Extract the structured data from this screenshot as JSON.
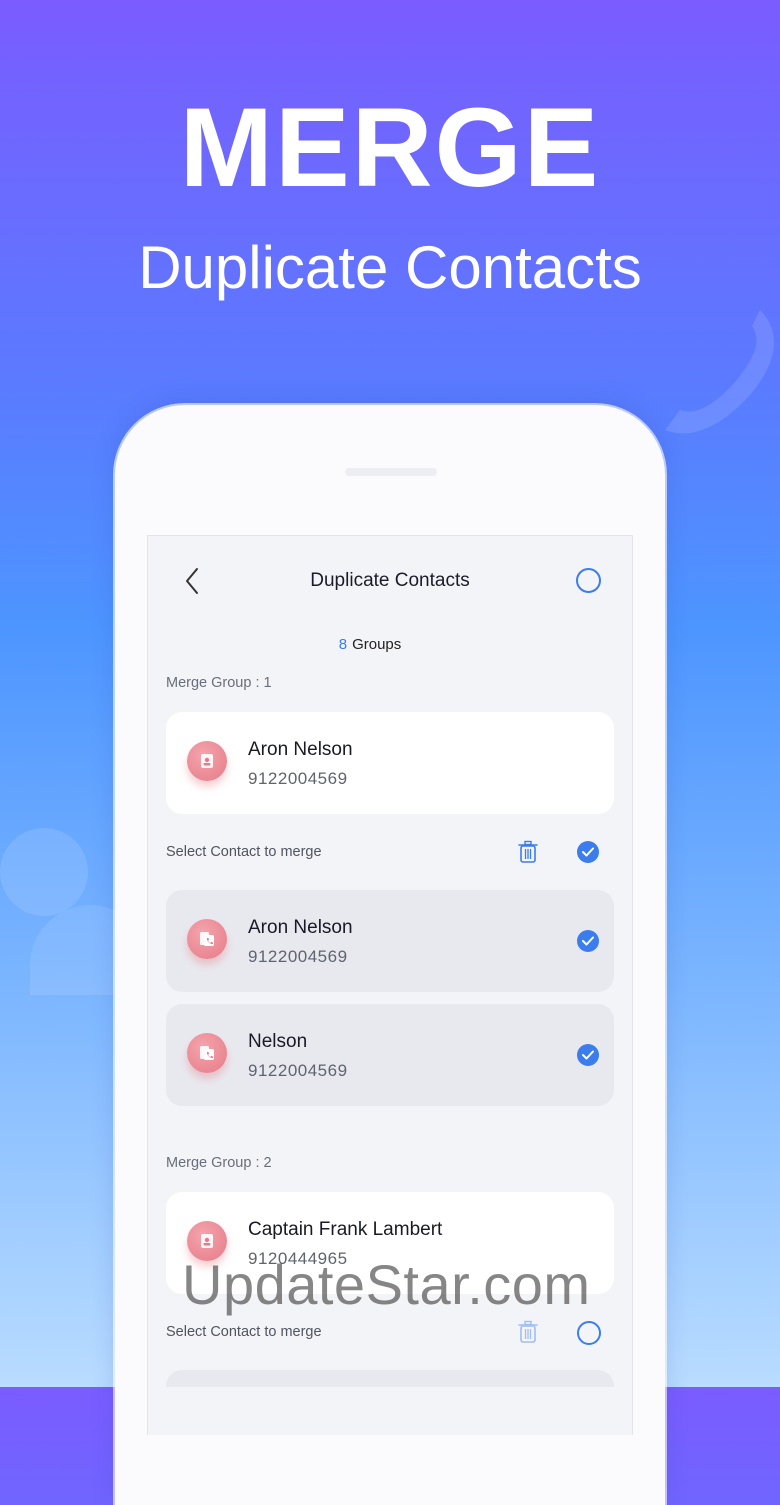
{
  "hero": {
    "title": "MERGE",
    "subtitle": "Duplicate Contacts"
  },
  "screen": {
    "nav_title": "Duplicate Contacts",
    "groups_count": "8",
    "groups_label": "Groups",
    "groups": [
      {
        "label": "Merge Group : 1",
        "primary": {
          "name": "Aron Nelson",
          "phone": "9122004569"
        },
        "select_label": "Select Contact to merge",
        "duplicates": [
          {
            "name": "Aron Nelson",
            "phone": "9122004569",
            "checked": true
          },
          {
            "name": "Nelson",
            "phone": "9122004569",
            "checked": true
          }
        ]
      },
      {
        "label": "Merge Group : 2",
        "primary": {
          "name": "Captain Frank Lambert",
          "phone": "9120444965"
        },
        "select_label": "Select Contact to merge"
      }
    ]
  },
  "watermark": "UpdateStar.com",
  "colors": {
    "accent": "#3b7ded",
    "avatar": "#e8838e",
    "gradient_top": "#7a5cff",
    "gradient_bottom": "#b9dcff"
  }
}
